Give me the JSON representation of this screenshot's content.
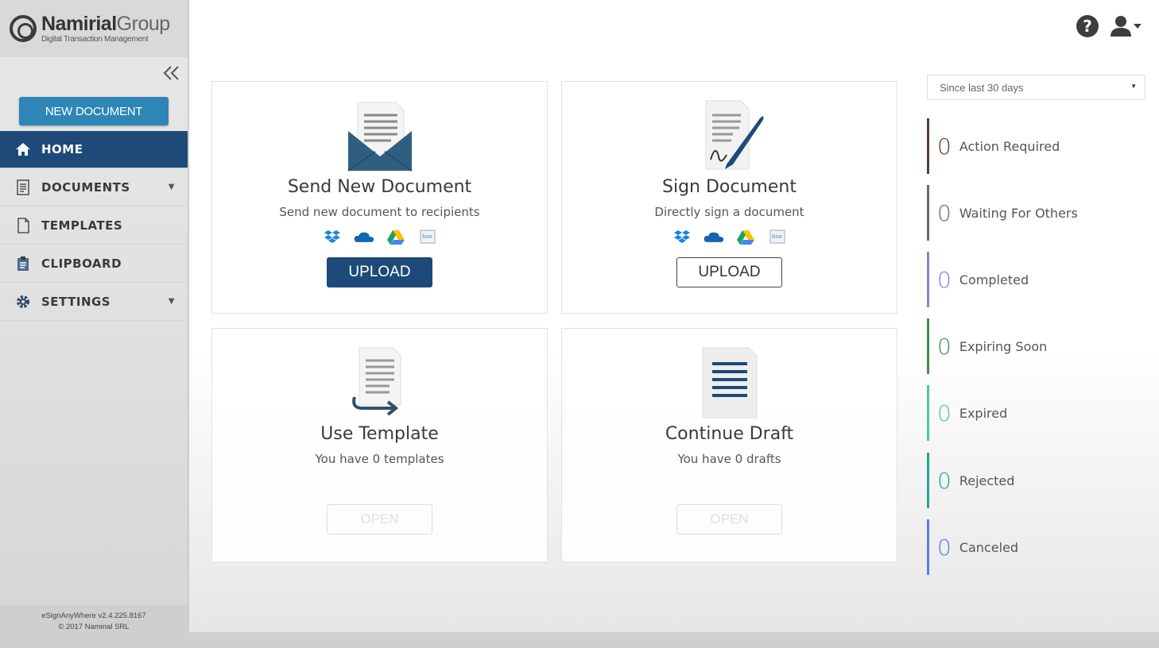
{
  "brand": {
    "name_bold": "Namirial",
    "name_light": "Group",
    "tagline": "Digital Transaction Management"
  },
  "sidebar": {
    "new_document_label": "NEW DOCUMENT",
    "items": [
      {
        "label": "HOME",
        "icon": "home-icon",
        "active": true
      },
      {
        "label": "DOCUMENTS",
        "icon": "documents-icon",
        "has_caret": true
      },
      {
        "label": "TEMPLATES",
        "icon": "templates-icon"
      },
      {
        "label": "CLIPBOARD",
        "icon": "clipboard-icon"
      },
      {
        "label": "SETTINGS",
        "icon": "gear-icon",
        "has_caret": true
      }
    ],
    "version": "eSignAnyWhere v2.4.225.8167",
    "copyright": "© 2017 Namirial SRL"
  },
  "cards": {
    "send": {
      "title": "Send New Document",
      "subtitle": "Send new document to recipients",
      "button": "UPLOAD"
    },
    "sign": {
      "title": "Sign Document",
      "subtitle": "Directly sign a document",
      "button": "UPLOAD"
    },
    "template": {
      "title": "Use Template",
      "subtitle": "You have 0 templates",
      "button": "OPEN"
    },
    "draft": {
      "title": "Continue Draft",
      "subtitle": "You have 0 drafts",
      "button": "OPEN"
    },
    "services": [
      "dropbox-icon",
      "onedrive-icon",
      "google-drive-icon",
      "box-icon"
    ],
    "box_label": "box"
  },
  "stats": {
    "range": "Since last 30 days",
    "items": [
      {
        "count": "0",
        "label": "Action Required",
        "color": "#5a3e2b"
      },
      {
        "count": "0",
        "label": "Waiting For Others",
        "color": "#6b6b6b"
      },
      {
        "count": "0",
        "label": "Completed",
        "color": "#8f7fc9"
      },
      {
        "count": "0",
        "label": "Expiring Soon",
        "color": "#3f8f4f"
      },
      {
        "count": "0",
        "label": "Expired",
        "color": "#4fc8a0"
      },
      {
        "count": "0",
        "label": "Rejected",
        "color": "#2aa39a"
      },
      {
        "count": "0",
        "label": "Canceled",
        "color": "#5b7fd6"
      }
    ]
  }
}
